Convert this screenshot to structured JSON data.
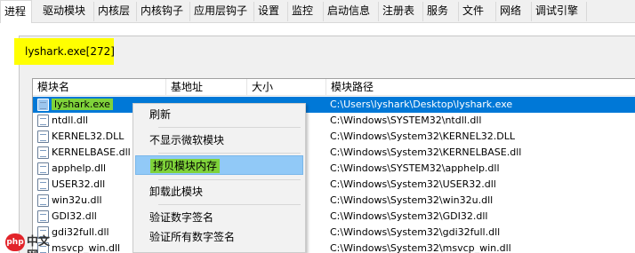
{
  "tabs": [
    {
      "label": "进程",
      "active": true
    },
    {
      "label": "驱动模块"
    },
    {
      "label": "内核层"
    },
    {
      "label": "内核钩子"
    },
    {
      "label": "应用层钩子"
    },
    {
      "label": "设置"
    },
    {
      "label": "监控"
    },
    {
      "label": "启动信息"
    },
    {
      "label": "注册表"
    },
    {
      "label": "服务"
    },
    {
      "label": "文件"
    },
    {
      "label": "网络"
    },
    {
      "label": "调试引擎"
    }
  ],
  "process_title": "lyshark.exe[272]",
  "columns": [
    "模块名",
    "基地址",
    "大小",
    "模块路径"
  ],
  "modules": [
    {
      "name": "lyshark.exe",
      "path": "C:\\Users\\lyshark\\Desktop\\lyshark.exe",
      "selected": true
    },
    {
      "name": "ntdll.dll",
      "path": "C:\\Windows\\SYSTEM32\\ntdll.dll"
    },
    {
      "name": "KERNEL32.DLL",
      "path": "C:\\Windows\\System32\\KERNEL32.DLL"
    },
    {
      "name": "KERNELBASE.dll",
      "path": "C:\\Windows\\System32\\KERNELBASE.dll"
    },
    {
      "name": "apphelp.dll",
      "path": "C:\\Windows\\SYSTEM32\\apphelp.dll"
    },
    {
      "name": "USER32.dll",
      "path": "C:\\Windows\\System32\\USER32.dll"
    },
    {
      "name": "win32u.dll",
      "path": "C:\\Windows\\System32\\win32u.dll"
    },
    {
      "name": "GDI32.dll",
      "path": "C:\\Windows\\System32\\GDI32.dll"
    },
    {
      "name": "gdi32full.dll",
      "path": "C:\\Windows\\System32\\gdi32full.dll"
    },
    {
      "name": "msvcp_win.dll",
      "path": "C:\\Windows\\System32\\msvcp_win.dll"
    }
  ],
  "context_menu": {
    "refresh": "刷新",
    "hide_ms": "不显示微软模块",
    "copy_memory": "拷贝模块内存",
    "unload": "卸载此模块",
    "verify_sig": "验证数字签名",
    "verify_all": "验证所有数字签名"
  },
  "watermark": {
    "logo": "php",
    "text": "中文网"
  }
}
